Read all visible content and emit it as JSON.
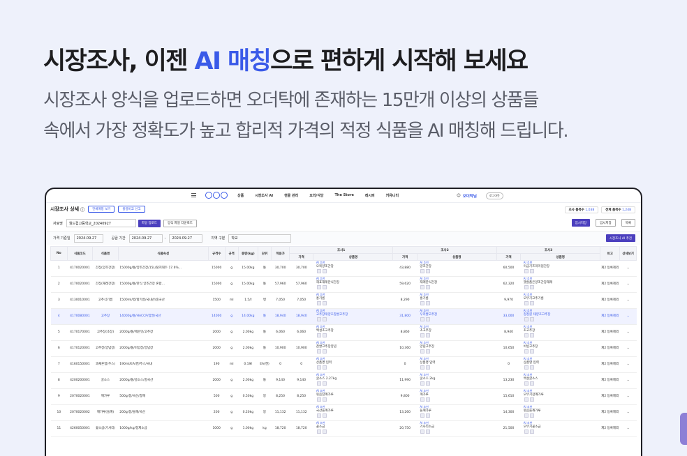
{
  "hero": {
    "headline_pre": "시장조사, 이젠 ",
    "headline_accent": "AI 매칭",
    "headline_post": "으로 편하게 시작해 보세요",
    "sub_line1": "시장조사 양식을 업로드하면 오더탁에 존재하는 15만개 이상의 상품들",
    "sub_line2": "속에서 가장 정확도가 높고 합리적 가격의 적정 식품을 AI 매칭해 드립니다."
  },
  "nav": {
    "items": [
      "상품",
      "시장조사 AI",
      "현물 관리",
      "오리/식당",
      "The Store",
      "레시피",
      "커뮤니티"
    ],
    "user": "오더탁님",
    "logout": "로그아웃"
  },
  "page": {
    "title": "시장조사 상세",
    "pill1": "전체매핑 보기",
    "pill2": "물량비교 신고",
    "info1_label": "조사 품목수",
    "info1_value": "1,038",
    "info2_label": "전체 품목수",
    "info2_value": "1,248"
  },
  "file": {
    "label": "자료명",
    "value": "월드컵고등학교_20240927",
    "upload": "파일 업로드",
    "download": "양식 파일 다운로드",
    "btn_temp": "임시저장",
    "btn_save": "목록"
  },
  "period": {
    "label": "가격 기준일",
    "date1": "2024.09.27",
    "label2": "공급 기간",
    "date2": "2024.09.27",
    "date3": "2024.09.27",
    "label3": "지역 구분",
    "region": "학교",
    "ai_btn": "시장조사 AI 추천"
  },
  "table": {
    "headers": [
      "No",
      "식품코드",
      "식품명",
      "식품속성",
      "규격수",
      "규격",
      "중량(kg)",
      "단위",
      "적용가",
      "가격",
      "상품명",
      "가격",
      "상품명",
      "가격",
      "상품명",
      "비고",
      "상세보기"
    ],
    "group1": "조사1",
    "group2": "조사2",
    "group3": "조사3",
    "ai_label": "AI 추천",
    "rows": [
      {
        "no": "1",
        "code": "4170020001",
        "name": "간장(양조간장)",
        "desc": "15000g/통/양조간장/15L/탈지대두 17.6%...",
        "qty": "15000",
        "unit": "g",
        "kg": "15.00kg",
        "u": "통",
        "price": "30,700",
        "p1": "30,700",
        "m1": "오복양조간장",
        "p2": "43,880",
        "m2": "양조간장",
        "p3": "60,500",
        "m3": "이금기프리미엄간장",
        "note": "제2 등록제외"
      },
      {
        "no": "2",
        "code": "4170020001",
        "name": "간장(재래간장)",
        "desc": "15000g/통/한식 양조간장 혼합...",
        "qty": "15000",
        "unit": "g",
        "kg": "15.00kg",
        "u": "통",
        "price": "57,960",
        "p1": "57,960",
        "m1": "해표재래한식간장",
        "p2": "59,620",
        "m2": "재래한식간장",
        "p3": "62,320",
        "m3": "햇살품은양조간장재래",
        "note": "제2 등록제외"
      },
      {
        "no": "3",
        "code": "4130010001",
        "name": "고추식기름",
        "desc": "1500ml/병/향기름/국내산/중국산",
        "qty": "1500",
        "unit": "ml",
        "kg": "1.5/ℓ",
        "u": "병",
        "price": "7,050",
        "p1": "7,050",
        "m1": "홍기름",
        "p2": "8,290",
        "m2": "홍기름",
        "p3": "9,970",
        "m3": "오뚜기고추기름",
        "note": "제2 등록제외"
      },
      {
        "no": "4",
        "code": "4170080001",
        "name": "고추장",
        "desc": "14000g/통/HACCP/찹쌀/국산",
        "qty": "14000",
        "unit": "g",
        "kg": "14.00kg",
        "u": "통",
        "price": "18,940",
        "p1": "18,940",
        "m1": "고추장태양초찹쌀고추장",
        "p2": "31,800",
        "m2": "우리쌀고추장",
        "p3": "33,000",
        "m3": "청정원 태양초고추장",
        "note": "제2 등록제외"
      },
      {
        "no": "5",
        "code": "4170170001",
        "name": "고추장(초장)",
        "desc": "2000g/통/매운맛/고추장",
        "qty": "2000",
        "unit": "g",
        "kg": "2.00kg",
        "u": "통",
        "price": "6,060",
        "p1": "6,060",
        "m1": "백설초고추장",
        "p2": "8,860",
        "m2": "초고추장",
        "p3": "8,940",
        "m3": "초고추장",
        "note": "제2 등록제외"
      },
      {
        "no": "6",
        "code": "4170120001",
        "name": "고추장(양념장)",
        "desc": "2000g/통/비빔장/양념장",
        "qty": "2000",
        "unit": "g",
        "kg": "2.00kg",
        "u": "통",
        "price": "10,900",
        "p1": "10,900",
        "m1": "찹쌀고추장양념",
        "p2": "10,360",
        "m2": "양념고추장",
        "p3": "10,650",
        "m3": "비빔고추장",
        "note": "제2 등록제외"
      },
      {
        "no": "7",
        "code": "4160150001",
        "name": "과채혼합(주스)",
        "desc": "190ml/EA/캔/주스/국내",
        "qty": "190",
        "unit": "ml",
        "kg": "0.19ℓ",
        "u": "EA(캔)",
        "price": "0",
        "p1": "0",
        "m1": "상품명 입력",
        "p2": "0",
        "m2": "상품명 입력",
        "p3": "0",
        "m3": "상품명 입력",
        "note": "제2 등록제외"
      },
      {
        "no": "8",
        "code": "4200200001",
        "name": "굴소스",
        "desc": "2000g/통/굴소스/중국산",
        "qty": "2000",
        "unit": "g",
        "kg": "2.00kg",
        "u": "통",
        "price": "9,140",
        "p1": "9,140",
        "m1": "굴소스 2.27kg",
        "p2": "11,990",
        "m2": "굴소스 2kg",
        "p3": "13,230",
        "m3": "백설굴소스",
        "note": "제2 등록제외"
      },
      {
        "no": "9",
        "code": "2070020001",
        "name": "깨가루",
        "desc": "500g/봉/국산/참깨",
        "qty": "500",
        "unit": "g",
        "kg": "0.50kg",
        "u": "봉",
        "price": "8,250",
        "p1": "8,250",
        "m1": "볶음참깨가루",
        "p2": "9,800",
        "m2": "깨가루",
        "p3": "15,610",
        "m3": "오뚜기참깨가루",
        "note": "제2 등록제외"
      },
      {
        "no": "10",
        "code": "2070020002",
        "name": "깨가루(들깨)",
        "desc": "200g/봉/들깨/국산",
        "qty": "200",
        "unit": "g",
        "kg": "0.20kg",
        "u": "봉",
        "price": "11,132",
        "p1": "11,132",
        "m1": "국산들깨가루",
        "p2": "13,260",
        "m2": "들깨가루",
        "p3": "14,300",
        "m3": "볶음들깨가루",
        "note": "제2 등록제외"
      },
      {
        "no": "11",
        "code": "4260050001",
        "name": "꽃소금(기사리)",
        "desc": "1000g/kg/정제소금",
        "qty": "1000",
        "unit": "g",
        "kg": "1.00kg",
        "u": "kg",
        "price": "18,720",
        "p1": "18,720",
        "m1": "꽃소금",
        "p2": "20,750",
        "m2": "기사리소금",
        "p3": "21,500",
        "m3": "오뚜기꽃소금",
        "note": "제2 등록제외"
      }
    ]
  }
}
